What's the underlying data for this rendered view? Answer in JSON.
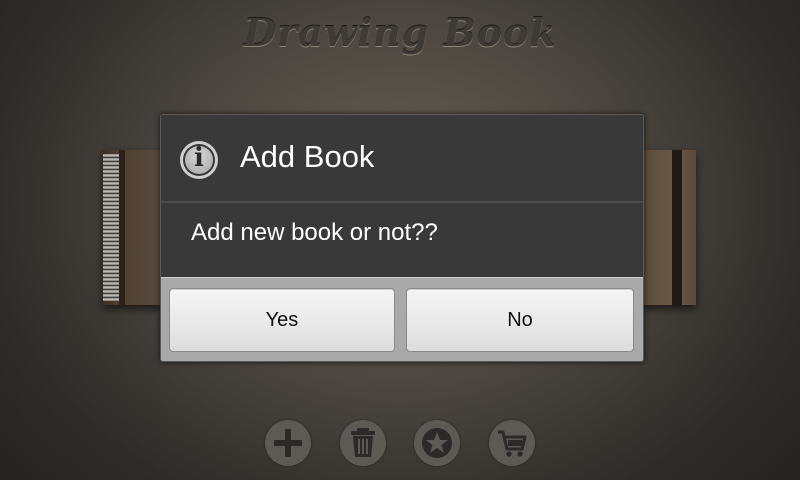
{
  "app": {
    "title": "Drawing Book"
  },
  "dialog": {
    "title": "Add Book",
    "icon": "info-icon",
    "message": "Add new book or not??",
    "yes_label": "Yes",
    "no_label": "No"
  },
  "toolbar": {
    "items": [
      {
        "name": "add-book-button",
        "icon": "plus-icon"
      },
      {
        "name": "delete-book-button",
        "icon": "trash-icon"
      },
      {
        "name": "favorite-button",
        "icon": "star-icon"
      },
      {
        "name": "store-button",
        "icon": "cart-icon"
      }
    ]
  },
  "colors": {
    "dialog_background": "#393939",
    "button_background": "#eeeeee",
    "toolbar_button": "#5d5a56",
    "toolbar_icon": "#2b2a28"
  }
}
